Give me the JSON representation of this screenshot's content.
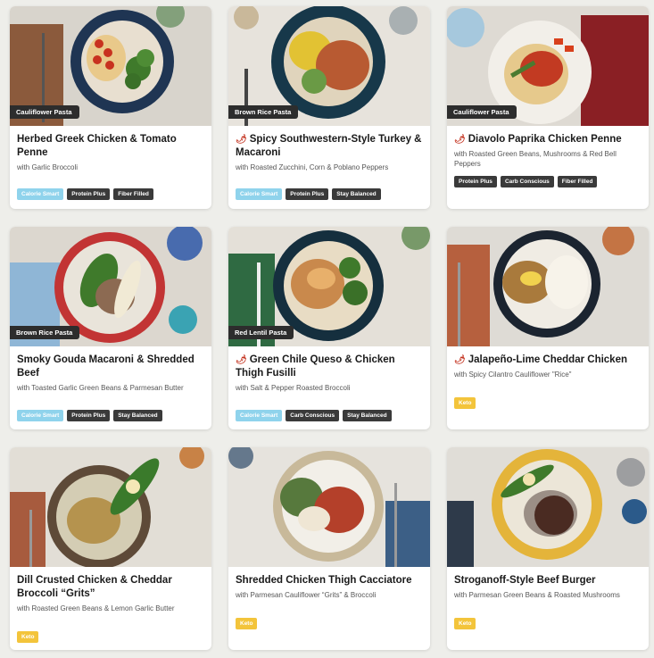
{
  "colors": {
    "calorie_smart": "#8fd3ec",
    "dark_badge": "#3a3a3a",
    "keto": "#f3c43b",
    "spicy": "#c4321f"
  },
  "cards": [
    {
      "tag": "Cauliflower Pasta",
      "spicy": false,
      "title": "Herbed Greek Chicken & Tomato Penne",
      "subtitle": "with Garlic Broccoli",
      "badges": [
        "Calorie Smart",
        "Protein Plus",
        "Fiber Filled"
      ]
    },
    {
      "tag": "Brown Rice Pasta",
      "spicy": true,
      "title": "Spicy Southwestern-Style Turkey & Macaroni",
      "subtitle": "with Roasted Zucchini, Corn & Poblano Peppers",
      "badges": [
        "Calorie Smart",
        "Protein Plus",
        "Stay Balanced"
      ]
    },
    {
      "tag": "Cauliflower Pasta",
      "spicy": true,
      "title": "Diavolo Paprika Chicken Penne",
      "subtitle": "with Roasted Green Beans, Mushrooms & Red Bell Peppers",
      "badges": [
        "Protein Plus",
        "Carb Conscious",
        "Fiber Filled"
      ]
    },
    {
      "tag": "Brown Rice Pasta",
      "spicy": false,
      "title": "Smoky Gouda Macaroni & Shredded Beef",
      "subtitle": "with Toasted Garlic Green Beans & Parmesan Butter",
      "badges": [
        "Calorie Smart",
        "Protein Plus",
        "Stay Balanced"
      ]
    },
    {
      "tag": "Red Lentil Pasta",
      "spicy": true,
      "title": "Green Chile Queso & Chicken Thigh Fusilli",
      "subtitle": "with Salt & Pepper Roasted Broccoli",
      "badges": [
        "Calorie Smart",
        "Carb Conscious",
        "Stay Balanced"
      ]
    },
    {
      "tag": "",
      "spicy": true,
      "title": "Jalapeño-Lime Cheddar Chicken",
      "subtitle": "with Spicy Cilantro Cauliflower \"Rice\"",
      "badges": [
        "Keto"
      ]
    },
    {
      "tag": "",
      "spicy": false,
      "title": "Dill Crusted Chicken & Cheddar Broccoli “Grits”",
      "subtitle": "with Roasted Green Beans & Lemon Garlic Butter",
      "badges": [
        "Keto"
      ]
    },
    {
      "tag": "",
      "spicy": false,
      "title": "Shredded Chicken Thigh Cacciatore",
      "subtitle": "with Parmesan Cauliflower “Grits” & Broccoli",
      "badges": [
        "Keto"
      ]
    },
    {
      "tag": "",
      "spicy": false,
      "title": "Stroganoff-Style Beef Burger",
      "subtitle": "with Parmesan Green Beans & Roasted Mushrooms",
      "badges": [
        "Keto"
      ]
    }
  ]
}
